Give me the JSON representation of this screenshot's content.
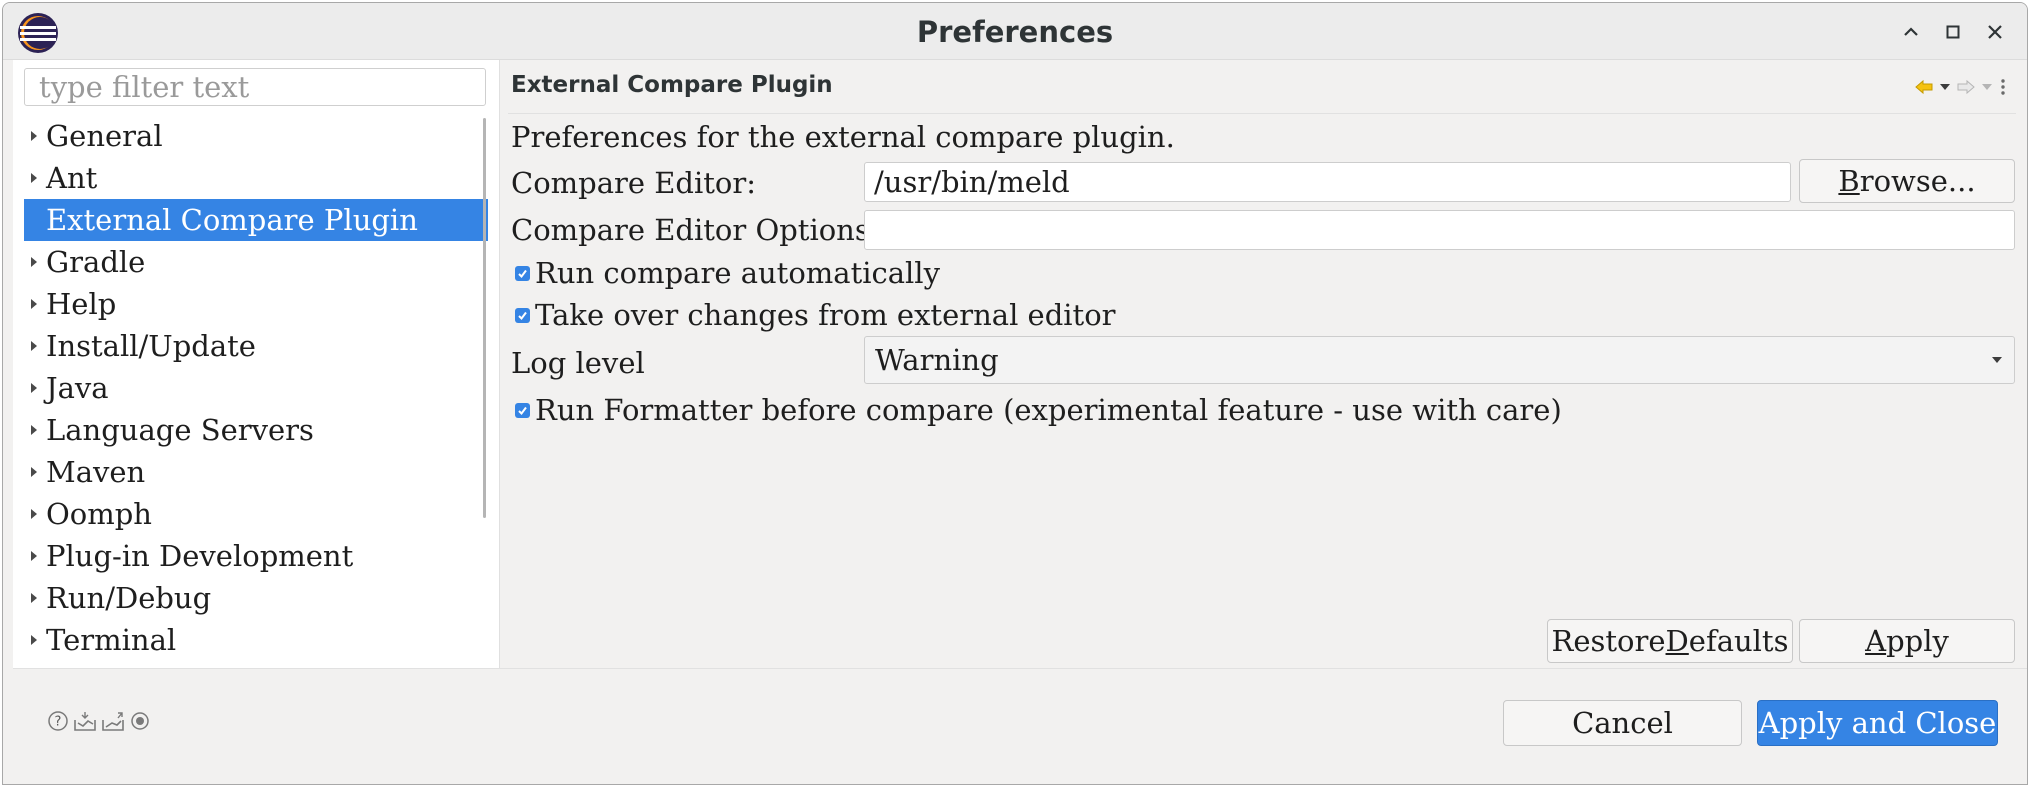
{
  "window": {
    "title": "Preferences"
  },
  "filter": {
    "placeholder": "type filter text"
  },
  "tree": [
    {
      "label": "General",
      "expandable": true,
      "selected": false
    },
    {
      "label": "Ant",
      "expandable": true,
      "selected": false
    },
    {
      "label": "External Compare Plugin",
      "expandable": false,
      "selected": true
    },
    {
      "label": "Gradle",
      "expandable": true,
      "selected": false
    },
    {
      "label": "Help",
      "expandable": true,
      "selected": false
    },
    {
      "label": "Install/Update",
      "expandable": true,
      "selected": false
    },
    {
      "label": "Java",
      "expandable": true,
      "selected": false
    },
    {
      "label": "Language Servers",
      "expandable": true,
      "selected": false
    },
    {
      "label": "Maven",
      "expandable": true,
      "selected": false
    },
    {
      "label": "Oomph",
      "expandable": true,
      "selected": false
    },
    {
      "label": "Plug-in Development",
      "expandable": true,
      "selected": false
    },
    {
      "label": "Run/Debug",
      "expandable": true,
      "selected": false
    },
    {
      "label": "Terminal",
      "expandable": true,
      "selected": false
    }
  ],
  "page": {
    "title": "External Compare Plugin",
    "description": "Preferences for the external compare plugin.",
    "compare_editor": {
      "label": "Compare Editor:",
      "value": "/usr/bin/meld"
    },
    "browse": {
      "pre": "",
      "mnemonic": "B",
      "post": "rowse..."
    },
    "compare_options": {
      "label": "Compare Editor Options:",
      "value": ""
    },
    "run_auto": {
      "label": "Run compare automatically",
      "checked": true
    },
    "take_over": {
      "label": "Take over changes from external editor",
      "checked": true
    },
    "log_level": {
      "label": "Log level",
      "value": "Warning"
    },
    "run_formatter": {
      "label": "Run Formatter before compare (experimental feature - use with care)",
      "checked": true
    },
    "restore": {
      "pre": "Restore ",
      "mnemonic": "D",
      "post": "efaults"
    },
    "apply": {
      "pre": "",
      "mnemonic": "A",
      "post": "pply"
    }
  },
  "footer": {
    "cancel": "Cancel",
    "apply_close": "Apply and Close",
    "icons": [
      "help-icon",
      "import-icon",
      "export-icon",
      "record-icon"
    ]
  },
  "colors": {
    "accent": "#3584e4",
    "background": "#f2f1f0"
  }
}
